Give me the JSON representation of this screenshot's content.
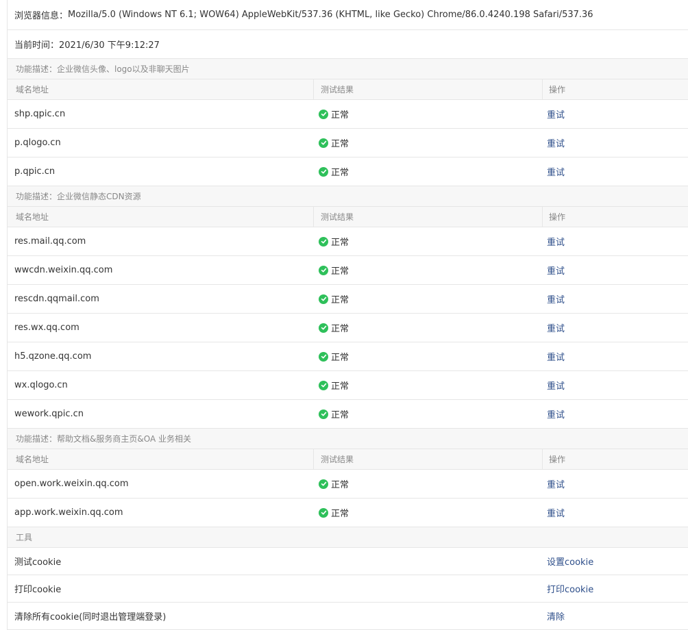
{
  "browser_info": {
    "label": "浏览器信息：",
    "value": "Mozilla/5.0 (Windows NT 6.1; WOW64) AppleWebKit/537.36 (KHTML, like Gecko) Chrome/86.0.4240.198 Safari/537.36"
  },
  "current_time": {
    "label": "当前时间：",
    "value": "2021/6/30 下午9:12:27"
  },
  "columns": {
    "domain": "域名地址",
    "result": "测试结果",
    "operation": "操作"
  },
  "status_ok": "正常",
  "retry_label": "重试",
  "sections": [
    {
      "title": "功能描述：企业微信头像、logo以及非聊天图片",
      "rows": [
        "shp.qpic.cn",
        "p.qlogo.cn",
        "p.qpic.cn"
      ]
    },
    {
      "title": "功能描述：企业微信静态CDN资源",
      "rows": [
        "res.mail.qq.com",
        "wwcdn.weixin.qq.com",
        "rescdn.qqmail.com",
        "res.wx.qq.com",
        "h5.qzone.qq.com",
        "wx.qlogo.cn",
        "wework.qpic.cn"
      ]
    },
    {
      "title": "功能描述：帮助文档&服务商主页&OA 业务相关",
      "rows": [
        "open.work.weixin.qq.com",
        "app.work.weixin.qq.com"
      ]
    }
  ],
  "tools": {
    "title": "工具",
    "items": [
      {
        "label": "测试cookie",
        "action": "设置cookie"
      },
      {
        "label": "打印cookie",
        "action": "打印cookie"
      },
      {
        "label": "清除所有cookie(同时退出管理端登录)",
        "action": "清除"
      }
    ]
  },
  "colors": {
    "ok_green": "#2ec05a",
    "link_blue": "#2d4e8a",
    "border": "#e6e6e6",
    "header_bg": "#f7f7f7"
  }
}
